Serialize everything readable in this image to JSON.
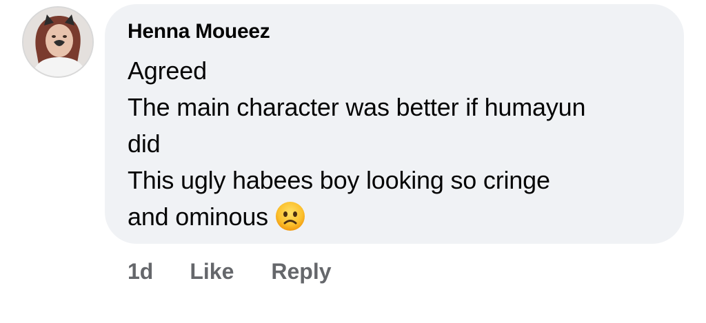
{
  "comment": {
    "author": "Henna Moueez",
    "lines": [
      "Agreed",
      "The main character was better if humayun",
      "did",
      "This ugly habees boy looking so cringe",
      "and ominous"
    ],
    "emoji": "frowning-face-emoji",
    "timestamp": "1d",
    "like_label": "Like",
    "reply_label": "Reply"
  },
  "colors": {
    "bubble": "#f0f2f5",
    "text": "#050505",
    "action_text": "#65676b"
  }
}
